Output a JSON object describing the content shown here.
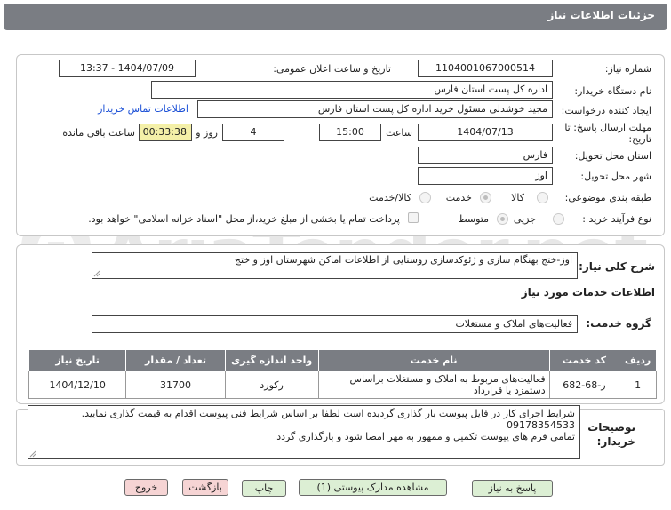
{
  "header": {
    "title": "جزئیات اطلاعات نیاز"
  },
  "watermark": {
    "text": "AriaTender.net"
  },
  "form": {
    "need_number_label": "شماره نیاز:",
    "need_number": "1104001067000514",
    "announce_label": "تاریخ و ساعت اعلان عمومی:",
    "announce_value": "1404/07/09 - 13:37",
    "buyer_label": "نام دستگاه خریدار:",
    "buyer_value": "اداره کل پست استان فارس",
    "creator_label": "ایجاد کننده درخواست:",
    "creator_value": "مجید خوشدلی مسئول خرید اداره کل پست استان فارس",
    "contact_link": "اطلاعات تماس خریدار",
    "deadline_label_1": "مهلت ارسال پاسخ: تا",
    "deadline_label_2": "تاریخ:",
    "deadline_date": "1404/07/13",
    "time_label": "ساعت",
    "deadline_time": "15:00",
    "days_value": "4",
    "days_label": "روز و",
    "remaining_value": "00:33:38",
    "remaining_label": "ساعت باقی مانده",
    "province_label": "استان محل تحویل:",
    "province_value": "فارس",
    "city_label": "شهر محل تحویل:",
    "city_value": "اوز",
    "category_label": "طبقه بندی موضوعی:",
    "category_options": [
      "کالا",
      "خدمت",
      "کالا/خدمت"
    ],
    "category_selected": "خدمت",
    "process_label": "نوع فرآیند خرید :",
    "process_options": [
      "جزیی",
      "متوسط"
    ],
    "process_selected": "متوسط",
    "payment_note": "پرداخت تمام یا بخشی از مبلغ خرید،از محل \"اسناد خزانه اسلامی\" خواهد بود."
  },
  "summary": {
    "label": "شرح کلی نیاز:",
    "value": "اوز-ختج بهنگام سازی و ژئوکدسازی روستایی از اطلاعات اماکن شهرستان اوز و ختج"
  },
  "services": {
    "section_title": "اطلاعات خدمات مورد نیاز",
    "group_label": "گروه خدمت:",
    "group_value": "فعالیت‌های  املاک و مستغلات",
    "columns": [
      "ردیف",
      "کد خدمت",
      "نام خدمت",
      "واحد اندازه گیری",
      "تعداد / مقدار",
      "تاریخ نیاز"
    ],
    "rows": [
      {
        "row": "1",
        "code": "ر-68-682",
        "name": "فعالیت‌های مربوط به املاک و مستغلات براساس دستمزد یا قرارداد",
        "unit": "رکورد",
        "qty": "31700",
        "date": "1404/12/10"
      }
    ]
  },
  "notes": {
    "label_1": "توضیحات",
    "label_2": "خریدار:",
    "line1": "شرایط اجرای کار در فایل پیوست بار گذاری گردیده است لطفا بر اساس شرایط فنی پیوست اقدام به قیمت گذاری نمایید.",
    "line2": "09178354533",
    "line3": "تمامی فرم های پیوست تکمیل و ممهور به مهر امضا شود و بارگذاری گردد"
  },
  "buttons": {
    "reply": "پاسخ به نیاز",
    "attachments": "مشاهده مدارک پیوستی (1)",
    "print": "چاپ",
    "back": "بازگشت",
    "exit": "خروج"
  },
  "colors": {
    "header": "#7a7d83",
    "button_green": "#dcefd4",
    "button_red": "#f6d4d4",
    "remaining_bg": "#f4f0a8",
    "link": "#1a4fd6"
  }
}
